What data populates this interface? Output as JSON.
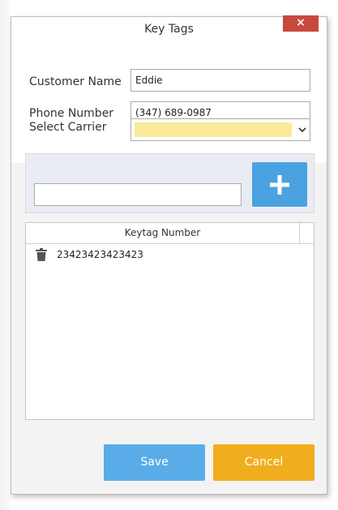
{
  "window": {
    "title": "Key Tags",
    "close_label": "×"
  },
  "form": {
    "customer_name_label": "Customer Name",
    "customer_name_value": "Eddie",
    "phone_number_label": "Phone Number",
    "phone_number_value": "(347) 689-0987",
    "select_carrier_label": "Select Carrier",
    "select_carrier_value": ""
  },
  "add_panel": {
    "keytag_input_value": "",
    "add_icon": "plus-icon"
  },
  "grid": {
    "column_header": "Keytag Number",
    "rows": [
      {
        "keytag": "23423423423423",
        "action_icon": "trash-icon"
      }
    ]
  },
  "actions": {
    "save_label": "Save",
    "cancel_label": "Cancel"
  },
  "colors": {
    "accent_blue": "#4aa3e0",
    "save_blue": "#5aace8",
    "cancel_orange": "#f0ad1e",
    "close_red": "#c9483e",
    "carrier_highlight": "#faeb9a"
  }
}
